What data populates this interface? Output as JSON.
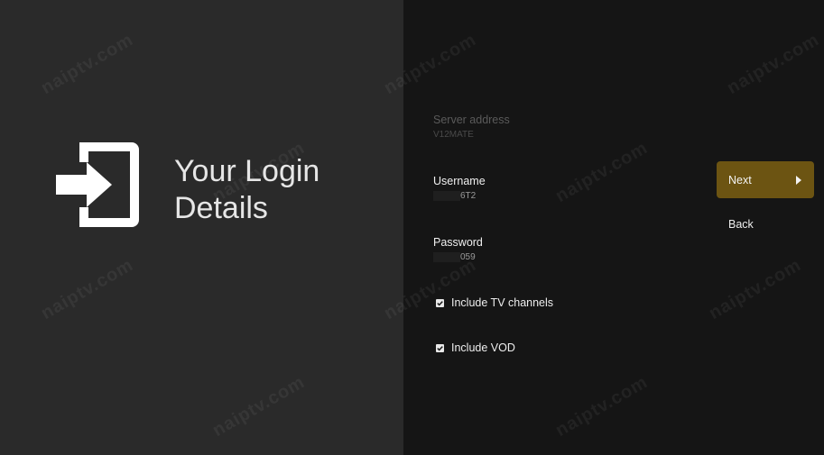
{
  "header": {
    "title_line1": "Your Login",
    "title_line2": "Details",
    "icon": "login-icon"
  },
  "form": {
    "server": {
      "label": "Server address",
      "value": "V12MATE",
      "enabled": false
    },
    "username": {
      "label": "Username",
      "value_visible": "6T2"
    },
    "password": {
      "label": "Password",
      "value_visible": "059"
    },
    "include_tv": {
      "label": "Include TV channels",
      "checked": true
    },
    "include_vod": {
      "label": "Include VOD",
      "checked": true
    }
  },
  "actions": {
    "next_label": "Next",
    "back_label": "Back"
  },
  "watermark": {
    "text": "naiptv.com"
  },
  "colors": {
    "left_panel": "#2a2a2a",
    "right_panel": "#151515",
    "accent_button": "#6c5412"
  }
}
